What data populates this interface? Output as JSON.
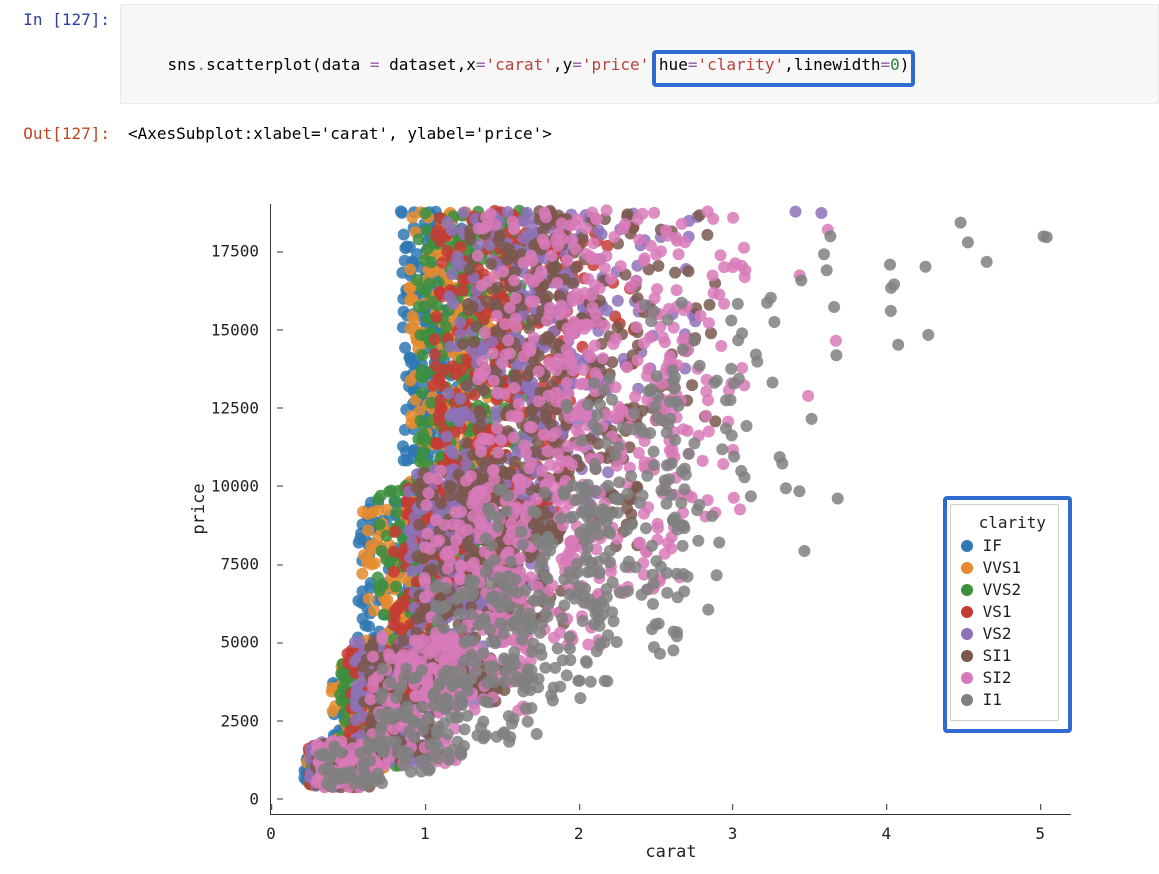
{
  "notebook": {
    "in_prompt": "In [127]:",
    "out_prompt": "Out[127]:",
    "code_tokens": [
      {
        "cls": "t-pl",
        "t": "sns"
      },
      {
        "cls": "t-op",
        "t": "."
      },
      {
        "cls": "t-pl",
        "t": "scatterplot"
      },
      {
        "cls": "t-pl",
        "t": "("
      },
      {
        "cls": "t-pl",
        "t": "data "
      },
      {
        "cls": "t-op",
        "t": "="
      },
      {
        "cls": "t-pl",
        "t": " dataset"
      },
      {
        "cls": "t-pl",
        "t": ","
      },
      {
        "cls": "t-pl",
        "t": "x"
      },
      {
        "cls": "t-op",
        "t": "="
      },
      {
        "cls": "t-str",
        "t": "'carat'"
      },
      {
        "cls": "t-pl",
        "t": ","
      },
      {
        "cls": "t-pl",
        "t": "y"
      },
      {
        "cls": "t-op",
        "t": "="
      },
      {
        "cls": "t-str",
        "t": "'price'"
      },
      {
        "cls": "t-pl",
        "t": ","
      },
      {
        "cls": "t-pl",
        "t": "hue"
      },
      {
        "cls": "t-op",
        "t": "="
      },
      {
        "cls": "t-str",
        "t": "'clarity'"
      },
      {
        "cls": "t-pl",
        "t": ","
      },
      {
        "cls": "t-pl",
        "t": "linewidth"
      },
      {
        "cls": "t-op",
        "t": "="
      },
      {
        "cls": "t-num",
        "t": "0"
      },
      {
        "cls": "t-pl",
        "t": ")"
      }
    ],
    "out_text": "<AxesSubplot:xlabel='carat', ylabel='price'>"
  },
  "chart_data": {
    "type": "scatter",
    "title": "",
    "xlabel": "carat",
    "ylabel": "price",
    "xlim": [
      0,
      5.2
    ],
    "ylim": [
      -500,
      19000
    ],
    "xticks": [
      0,
      1,
      2,
      3,
      4,
      5
    ],
    "yticks": [
      0,
      2500,
      5000,
      7500,
      10000,
      12500,
      15000,
      17500
    ],
    "legend": {
      "title": "clarity",
      "entries": [
        {
          "name": "IF",
          "color": "#2f78b3"
        },
        {
          "name": "VVS1",
          "color": "#e58b2e"
        },
        {
          "name": "VVS2",
          "color": "#3c8f3e"
        },
        {
          "name": "VS1",
          "color": "#c63b34"
        },
        {
          "name": "VS2",
          "color": "#8d72b9"
        },
        {
          "name": "SI1",
          "color": "#7a584d"
        },
        {
          "name": "SI2",
          "color": "#d87ab9"
        },
        {
          "name": "I1",
          "color": "#808080"
        }
      ]
    },
    "series": [
      {
        "name": "IF",
        "color": "#2f78b3",
        "bands": [
          {
            "xr": [
              0.22,
              0.4
            ],
            "yr": [
              400,
              1300
            ],
            "n": 45
          },
          {
            "xr": [
              0.4,
              0.7
            ],
            "yr": [
              900,
              4200
            ],
            "n": 70
          },
          {
            "xr": [
              0.55,
              0.95
            ],
            "yr": [
              3000,
              9500
            ],
            "n": 120
          },
          {
            "xr": [
              0.85,
              1.1
            ],
            "yr": [
              6000,
              18800
            ],
            "n": 170
          },
          {
            "xr": [
              1.0,
              1.25
            ],
            "yr": [
              10000,
              18800
            ],
            "n": 90
          }
        ]
      },
      {
        "name": "VVS1",
        "color": "#e58b2e",
        "bands": [
          {
            "xr": [
              0.24,
              0.45
            ],
            "yr": [
              400,
              1500
            ],
            "n": 50
          },
          {
            "xr": [
              0.4,
              0.75
            ],
            "yr": [
              900,
              4300
            ],
            "n": 80
          },
          {
            "xr": [
              0.6,
              1.05
            ],
            "yr": [
              2800,
              9500
            ],
            "n": 140
          },
          {
            "xr": [
              0.9,
              1.3
            ],
            "yr": [
              6000,
              18800
            ],
            "n": 190
          },
          {
            "xr": [
              1.15,
              1.5
            ],
            "yr": [
              9500,
              18800
            ],
            "n": 110
          }
        ]
      },
      {
        "name": "VVS2",
        "color": "#3c8f3e",
        "bands": [
          {
            "xr": [
              0.25,
              0.5
            ],
            "yr": [
              400,
              1600
            ],
            "n": 55
          },
          {
            "xr": [
              0.45,
              0.85
            ],
            "yr": [
              1000,
              4500
            ],
            "n": 90
          },
          {
            "xr": [
              0.7,
              1.15
            ],
            "yr": [
              3000,
              10000
            ],
            "n": 150
          },
          {
            "xr": [
              0.95,
              1.4
            ],
            "yr": [
              6000,
              18800
            ],
            "n": 200
          },
          {
            "xr": [
              1.25,
              1.7
            ],
            "yr": [
              9500,
              18800
            ],
            "n": 120
          }
        ]
      },
      {
        "name": "VS1",
        "color": "#c63b34",
        "bands": [
          {
            "xr": [
              0.25,
              0.55
            ],
            "yr": [
              350,
              1700
            ],
            "n": 60
          },
          {
            "xr": [
              0.5,
              0.95
            ],
            "yr": [
              1100,
              4800
            ],
            "n": 100
          },
          {
            "xr": [
              0.8,
              1.3
            ],
            "yr": [
              3000,
              10000
            ],
            "n": 160
          },
          {
            "xr": [
              1.05,
              1.6
            ],
            "yr": [
              6000,
              18800
            ],
            "n": 210
          },
          {
            "xr": [
              1.4,
              1.95
            ],
            "yr": [
              9000,
              18800
            ],
            "n": 130
          },
          {
            "xr": [
              1.9,
              2.4
            ],
            "yr": [
              13000,
              18800
            ],
            "n": 30
          }
        ]
      },
      {
        "name": "VS2",
        "color": "#8d72b9",
        "bands": [
          {
            "xr": [
              0.26,
              0.6
            ],
            "yr": [
              350,
              1800
            ],
            "n": 65
          },
          {
            "xr": [
              0.55,
              1.05
            ],
            "yr": [
              1100,
              5000
            ],
            "n": 110
          },
          {
            "xr": [
              0.9,
              1.45
            ],
            "yr": [
              3000,
              10500
            ],
            "n": 170
          },
          {
            "xr": [
              1.15,
              1.8
            ],
            "yr": [
              6000,
              18800
            ],
            "n": 220
          },
          {
            "xr": [
              1.6,
              2.2
            ],
            "yr": [
              9000,
              18800
            ],
            "n": 140
          },
          {
            "xr": [
              2.2,
              2.8
            ],
            "yr": [
              13000,
              18800
            ],
            "n": 30
          },
          {
            "xr": [
              3.4,
              3.6
            ],
            "yr": [
              18500,
              18800
            ],
            "n": 2
          }
        ]
      },
      {
        "name": "SI1",
        "color": "#7a584d",
        "bands": [
          {
            "xr": [
              0.28,
              0.65
            ],
            "yr": [
              350,
              1800
            ],
            "n": 70
          },
          {
            "xr": [
              0.6,
              1.15
            ],
            "yr": [
              1100,
              5200
            ],
            "n": 120
          },
          {
            "xr": [
              0.95,
              1.55
            ],
            "yr": [
              3000,
              10500
            ],
            "n": 180
          },
          {
            "xr": [
              1.25,
              1.95
            ],
            "yr": [
              5500,
              18800
            ],
            "n": 230
          },
          {
            "xr": [
              1.7,
              2.4
            ],
            "yr": [
              8000,
              18800
            ],
            "n": 150
          },
          {
            "xr": [
              2.3,
              2.9
            ],
            "yr": [
              12000,
              18800
            ],
            "n": 35
          }
        ]
      },
      {
        "name": "SI2",
        "color": "#d87ab9",
        "bands": [
          {
            "xr": [
              0.3,
              0.7
            ],
            "yr": [
              350,
              1900
            ],
            "n": 75
          },
          {
            "xr": [
              0.65,
              1.25
            ],
            "yr": [
              1000,
              5200
            ],
            "n": 130
          },
          {
            "xr": [
              1.0,
              1.7
            ],
            "yr": [
              2800,
              10500
            ],
            "n": 190
          },
          {
            "xr": [
              1.35,
              2.15
            ],
            "yr": [
              4800,
              18800
            ],
            "n": 250
          },
          {
            "xr": [
              1.9,
              2.7
            ],
            "yr": [
              6500,
              18800
            ],
            "n": 180
          },
          {
            "xr": [
              2.5,
              3.1
            ],
            "yr": [
              9000,
              18800
            ],
            "n": 60
          },
          {
            "xr": [
              3.3,
              3.7
            ],
            "yr": [
              11000,
              18800
            ],
            "n": 4
          }
        ]
      },
      {
        "name": "I1",
        "color": "#808080",
        "bands": [
          {
            "xr": [
              0.32,
              0.75
            ],
            "yr": [
              350,
              1800
            ],
            "n": 45
          },
          {
            "xr": [
              0.7,
              1.3
            ],
            "yr": [
              800,
              4200
            ],
            "n": 80
          },
          {
            "xr": [
              1.05,
              1.75
            ],
            "yr": [
              1800,
              7000
            ],
            "n": 110
          },
          {
            "xr": [
              1.4,
              2.2
            ],
            "yr": [
              3000,
              10000
            ],
            "n": 140
          },
          {
            "xr": [
              1.9,
              2.7
            ],
            "yr": [
              4500,
              13500
            ],
            "n": 120
          },
          {
            "xr": [
              2.4,
              3.1
            ],
            "yr": [
              6000,
              16000
            ],
            "n": 60
          },
          {
            "xr": [
              3.0,
              3.7
            ],
            "yr": [
              7500,
              18000
            ],
            "n": 20
          },
          {
            "xr": [
              3.9,
              4.7
            ],
            "yr": [
              14500,
              18800
            ],
            "n": 10
          },
          {
            "xr": [
              4.95,
              5.1
            ],
            "yr": [
              17800,
              18200
            ],
            "n": 2
          }
        ]
      }
    ]
  },
  "annotations": {
    "code_highlight_text": "hue='clarity',linewidth=0"
  }
}
